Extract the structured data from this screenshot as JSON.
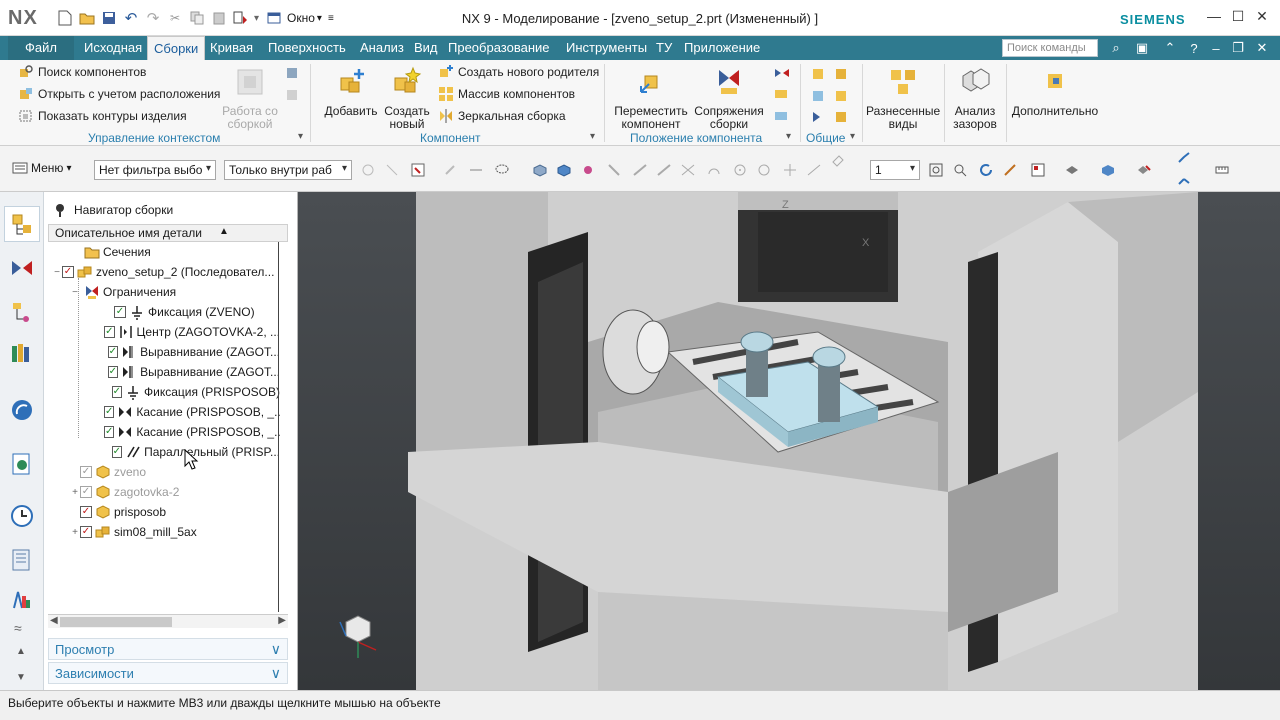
{
  "titlebar": {
    "app_logo": "NX",
    "title": "NX 9 - Моделирование - [zveno_setup_2.prt (Измененный) ]",
    "window_menu": "Окно",
    "brand": "SIEMENS",
    "icons": [
      "new-file-icon",
      "open-folder-icon",
      "save-icon",
      "undo-icon",
      "redo-icon",
      "cut-icon",
      "copy-icon",
      "paste-icon",
      "touch-mode-icon",
      "window-icon"
    ]
  },
  "tabs": {
    "file": "Файл",
    "items": [
      "Исходная",
      "Сборки",
      "Кривая",
      "Поверхность",
      "Анализ",
      "Вид",
      "Преобразование",
      "Инструменты",
      "ТУ",
      "Приложение"
    ],
    "active": "Сборки",
    "command_search_placeholder": "Поиск команды"
  },
  "ribbon": {
    "context_group": {
      "label": "Управление контекстом",
      "find_components": "Поиск компонентов",
      "open_by_proximity": "Открыть с учетом расположения",
      "show_product_outline": "Показать контуры изделия",
      "work_on_assembly": "Работа со сборкой"
    },
    "component_group": {
      "label": "Компонент",
      "add": "Добавить",
      "create_new": "Создать новый",
      "create_new_parent": "Создать нового родителя",
      "component_pattern": "Массив компонентов",
      "mirror_assembly": "Зеркальная сборка"
    },
    "position_group": {
      "label": "Положение компонента",
      "move_component": "Переместить компонент",
      "assembly_constraints": "Сопряжения сборки"
    },
    "general_group": {
      "label": "Общие"
    },
    "exploded_views": "Разнесенные виды",
    "clearance_analysis": "Анализ зазоров",
    "more": "Дополнительно"
  },
  "toolbar": {
    "menu": "Меню",
    "type_filter": "Нет фильтра выбо",
    "scope": "Только внутри раб",
    "layer": "1"
  },
  "navigator": {
    "title": "Навигатор сборки",
    "column_header": "Описательное имя детали",
    "rows": [
      {
        "label": "Сечения",
        "indent": 1,
        "expander": "",
        "check": "",
        "icon": "folder"
      },
      {
        "label": "zveno_setup_2 (Последовател...",
        "indent": 0,
        "expander": "−",
        "check": "red",
        "icon": "assembly"
      },
      {
        "label": "Ограничения",
        "indent": 1,
        "expander": "−",
        "check": "",
        "icon": "constraints"
      },
      {
        "label": "Фиксация (ZVENO)",
        "indent": 2,
        "expander": "",
        "check": "green",
        "icon": "fix"
      },
      {
        "label": "Центр (ZAGOTOVKA-2, ...",
        "indent": 2,
        "expander": "",
        "check": "green",
        "icon": "center"
      },
      {
        "label": "Выравнивание (ZAGOT...",
        "indent": 2,
        "expander": "",
        "check": "green",
        "icon": "align"
      },
      {
        "label": "Выравнивание (ZAGOT...",
        "indent": 2,
        "expander": "",
        "check": "green",
        "icon": "align"
      },
      {
        "label": "Фиксация (PRISPOSOB)",
        "indent": 2,
        "expander": "",
        "check": "green",
        "icon": "fix"
      },
      {
        "label": "Касание (PRISPOSOB, _...",
        "indent": 2,
        "expander": "",
        "check": "green",
        "icon": "touch"
      },
      {
        "label": "Касание (PRISPOSOB, _...",
        "indent": 2,
        "expander": "",
        "check": "green",
        "icon": "touch"
      },
      {
        "label": "Параллельный (PRISP...",
        "indent": 2,
        "expander": "",
        "check": "green",
        "icon": "parallel"
      },
      {
        "label": "zveno",
        "indent": 1,
        "expander": "",
        "check": "grey",
        "icon": "part",
        "grey": true
      },
      {
        "label": "zagotovka-2",
        "indent": 1,
        "expander": "+",
        "check": "grey",
        "icon": "part",
        "grey": true
      },
      {
        "label": "prisposob",
        "indent": 1,
        "expander": "",
        "check": "red",
        "icon": "part"
      },
      {
        "label": "sim08_mill_5ax",
        "indent": 1,
        "expander": "+",
        "check": "red",
        "icon": "assembly"
      }
    ],
    "preview": "Просмотр",
    "dependencies": "Зависимости"
  },
  "viewport": {
    "triad_labels": {
      "z": "Z",
      "x": "X"
    }
  },
  "status": {
    "message": "Выберите объекты и нажмите MB3 или дважды щелкните мышью на объекте"
  },
  "colors": {
    "tab_bar": "#2f7a8f",
    "accent_blue": "#2b7fae",
    "viewport_bg": "#3e4245",
    "machine_grey": "#d9d9d9",
    "part_blue": "#bfe0ec"
  }
}
